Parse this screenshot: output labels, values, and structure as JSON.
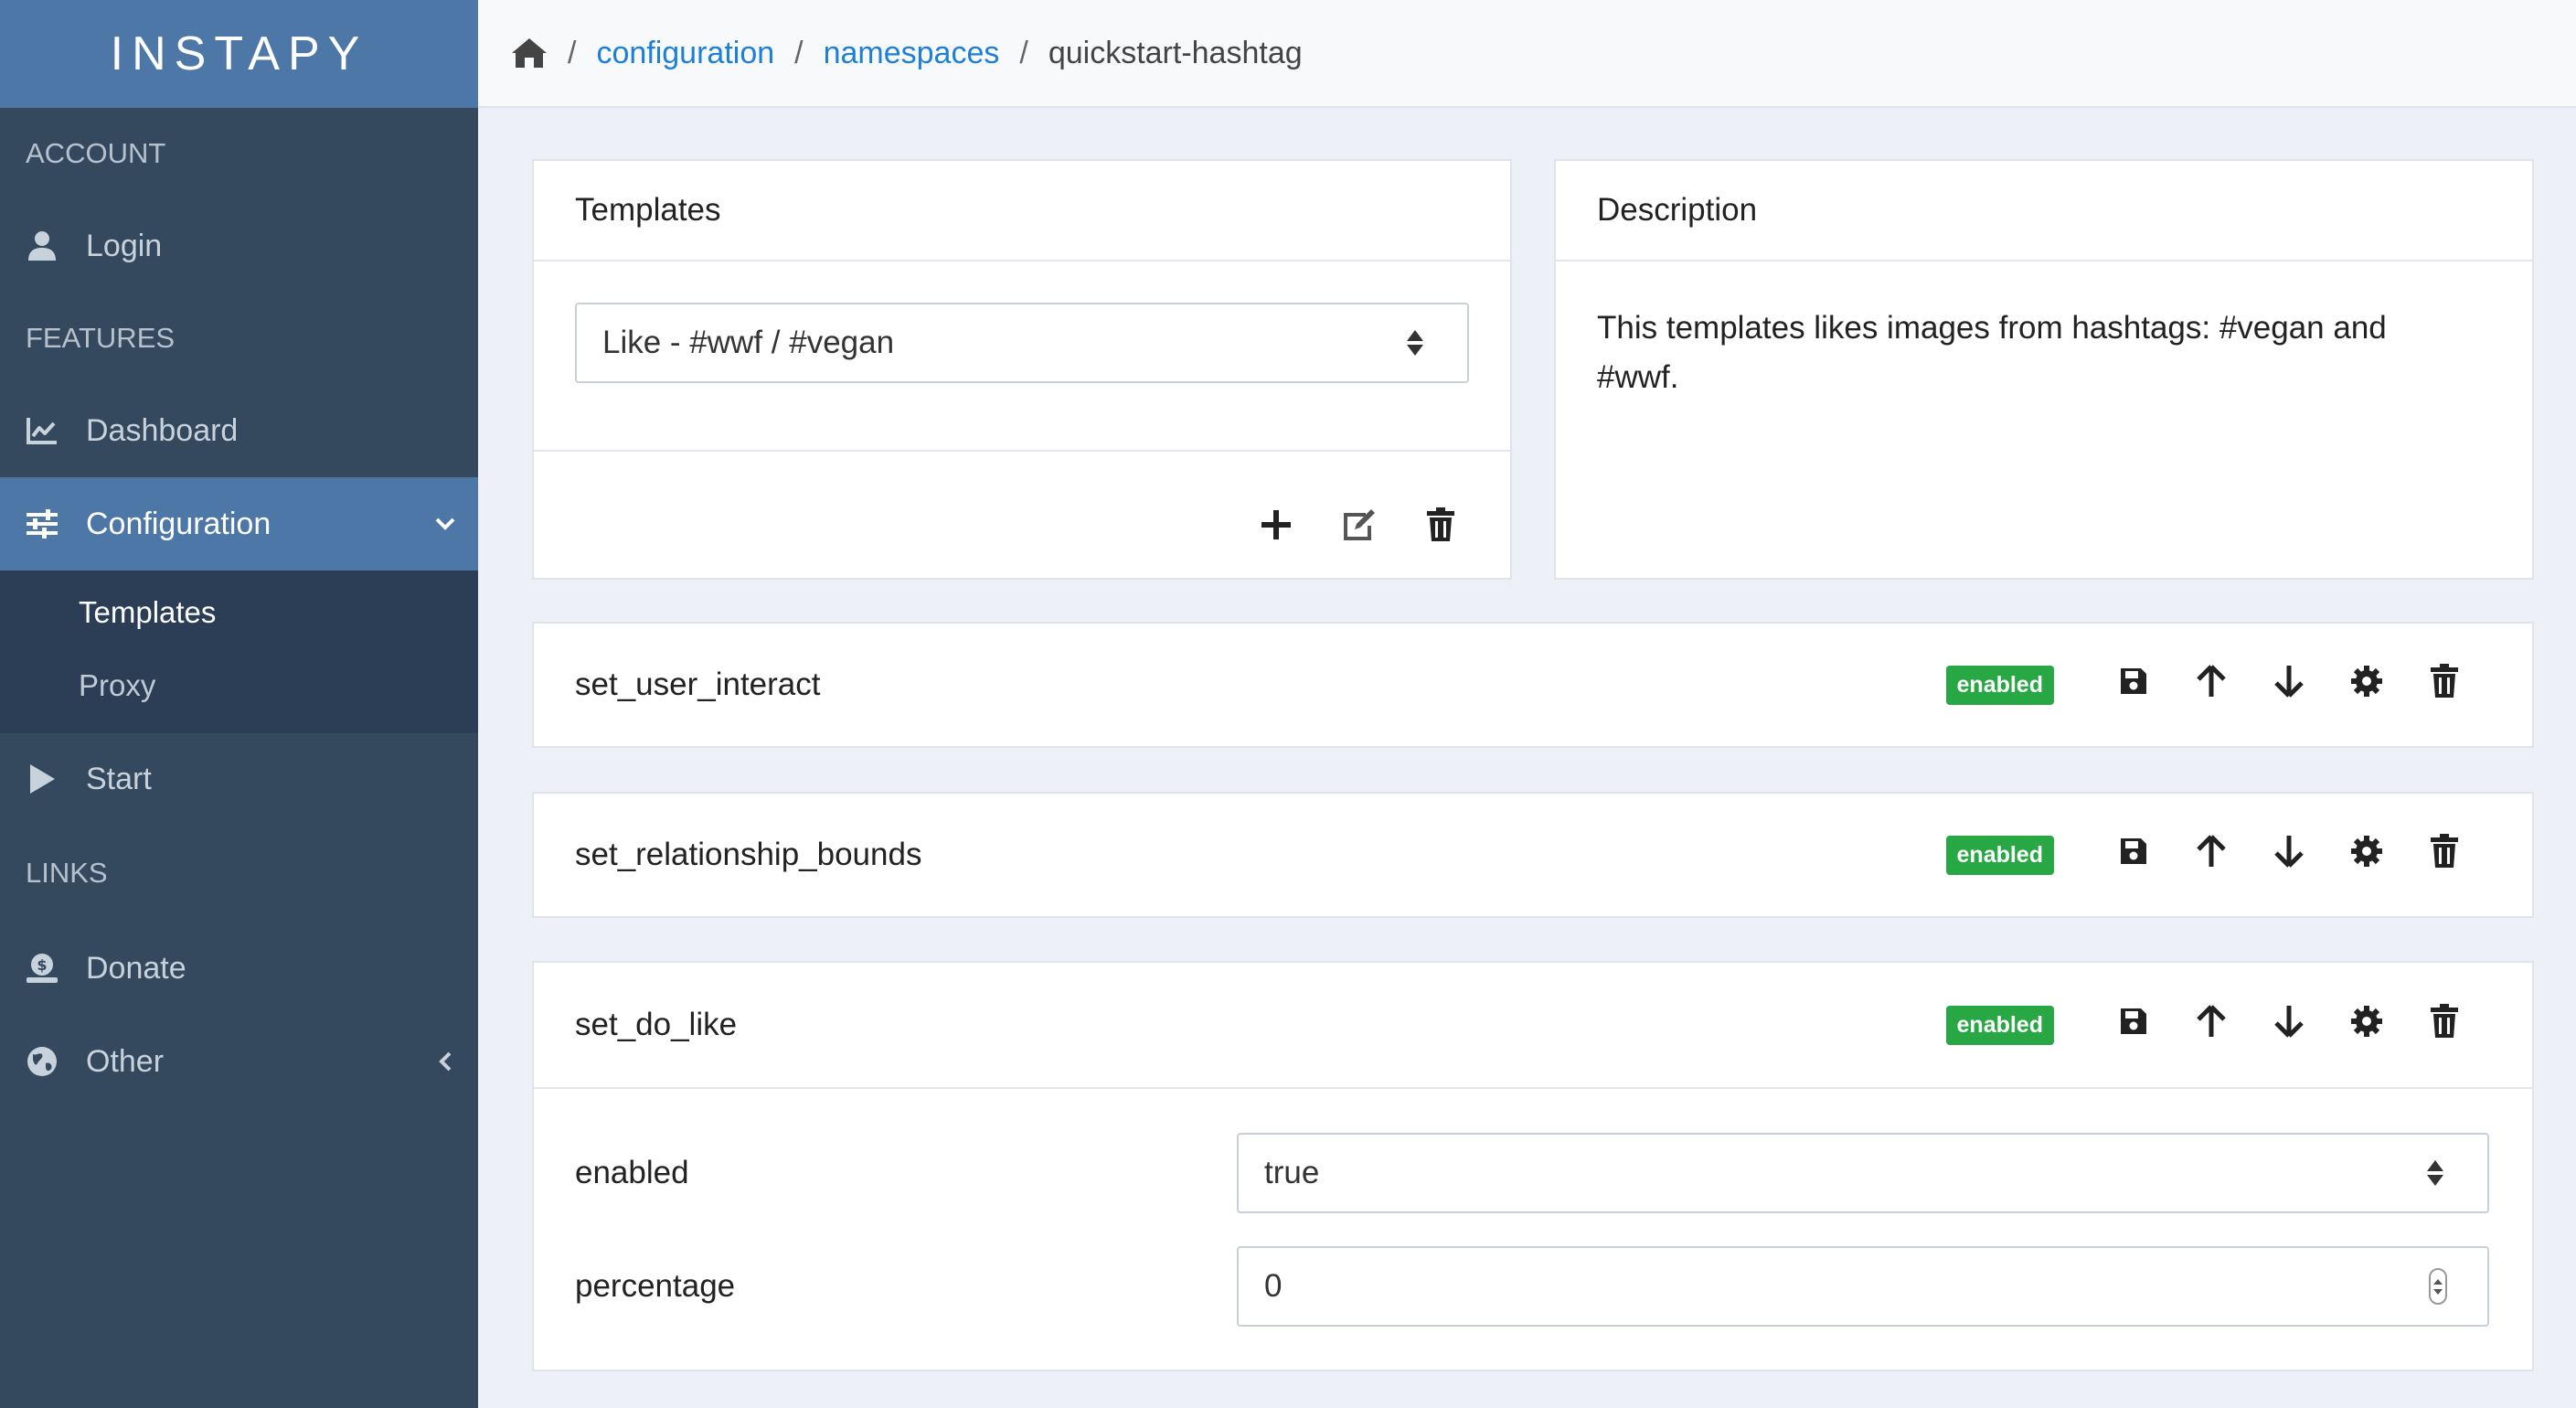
{
  "app": {
    "brand": "INSTAPY"
  },
  "sidebar": {
    "sections": {
      "account": "ACCOUNT",
      "features": "FEATURES",
      "links": "LINKS"
    },
    "items": {
      "login": "Login",
      "dashboard": "Dashboard",
      "configuration": "Configuration",
      "start": "Start",
      "donate": "Donate",
      "other": "Other"
    },
    "submenu": {
      "templates": "Templates",
      "proxy": "Proxy"
    },
    "active_item": "Configuration",
    "active_subitem": "Templates"
  },
  "breadcrumb": {
    "configuration": "configuration",
    "namespaces": "namespaces",
    "current": "quickstart-hashtag",
    "separator": "/"
  },
  "templates_card": {
    "title": "Templates",
    "selected": "Like - #wwf / #vegan"
  },
  "description_card": {
    "title": "Description",
    "text": "This templates likes images from hashtags: #vegan and #wwf."
  },
  "actions": [
    {
      "name": "set_user_interact",
      "status": "enabled"
    },
    {
      "name": "set_relationship_bounds",
      "status": "enabled"
    },
    {
      "name": "set_do_like",
      "status": "enabled"
    }
  ],
  "set_do_like_fields": {
    "enabled_label": "enabled",
    "enabled_value": "true",
    "percentage_label": "percentage",
    "percentage_value": "0"
  },
  "colors": {
    "sidebar_bg": "#34495e",
    "accent": "#4d77a7",
    "link": "#1e7fd6",
    "badge": "#28a745"
  }
}
